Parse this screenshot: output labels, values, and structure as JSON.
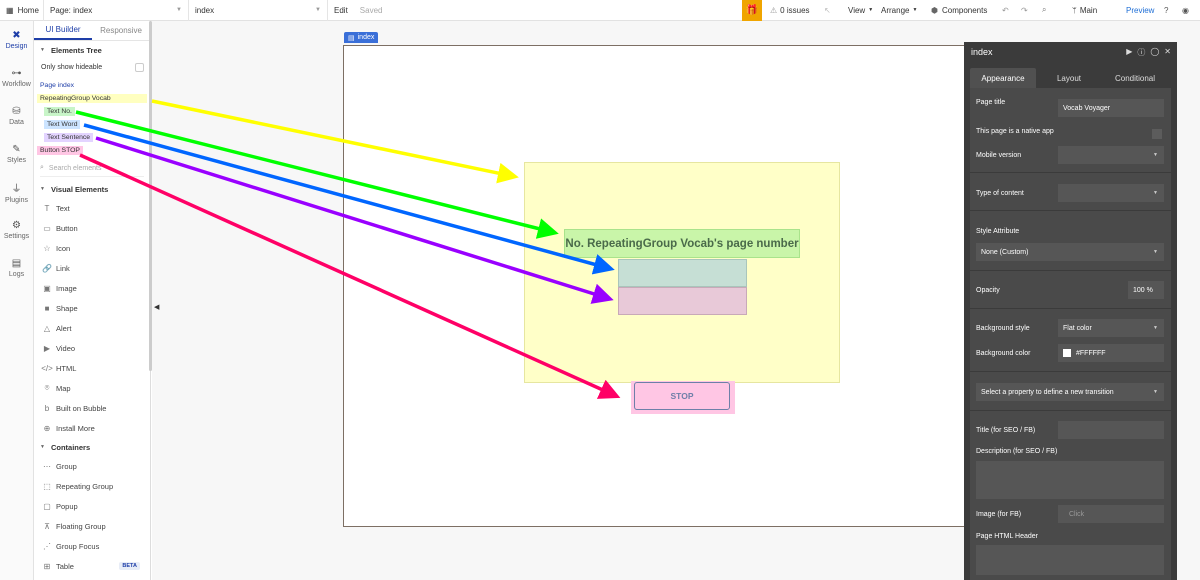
{
  "topbar": {
    "home": "Home",
    "page_label": "Page: index",
    "page_select": "index",
    "edit": "Edit",
    "saved": "Saved",
    "issues": "0 issues",
    "view": "View",
    "arrange": "Arrange",
    "components": "Components",
    "branch": "Main",
    "preview": "Preview"
  },
  "rail": [
    {
      "label": "Design",
      "icon": "design-icon"
    },
    {
      "label": "Workflow",
      "icon": "workflow-icon"
    },
    {
      "label": "Data",
      "icon": "data-icon"
    },
    {
      "label": "Styles",
      "icon": "styles-icon"
    },
    {
      "label": "Plugins",
      "icon": "plugins-icon"
    },
    {
      "label": "Settings",
      "icon": "settings-icon"
    },
    {
      "label": "Logs",
      "icon": "logs-icon"
    }
  ],
  "panel": {
    "tab_builder": "UI Builder",
    "tab_responsive": "Responsive",
    "elements_tree": "Elements Tree",
    "only_show_hideable": "Only show hideable",
    "tree": {
      "page": "Page index",
      "repeating_group": "RepeatingGroup Vocab",
      "text_no": "Text No.",
      "text_word": "Text Word",
      "text_sentence": "Text Sentence",
      "button_stop": "Button STOP"
    },
    "search_placeholder": "Search elements",
    "visual_elements": "Visual Elements",
    "visual": [
      "Text",
      "Button",
      "Icon",
      "Link",
      "Image",
      "Shape",
      "Alert",
      "Video",
      "HTML",
      "Map",
      "Built on Bubble",
      "Install More"
    ],
    "containers": "Containers",
    "container_items": [
      "Group",
      "Repeating Group",
      "Popup",
      "Floating Group",
      "Group Focus",
      "Table"
    ],
    "beta": "BETA"
  },
  "canvas": {
    "page_tag": "index",
    "text_no": "No. RepeatingGroup Vocab's page number",
    "button_stop": "STOP"
  },
  "props": {
    "title": "index",
    "tabs": [
      "Appearance",
      "Layout",
      "Conditional"
    ],
    "page_title_label": "Page title",
    "page_title_value": "Vocab Voyager",
    "native_app": "This page is a native app",
    "mobile_version": "Mobile version",
    "type_of_content": "Type of content",
    "style_attribute": "Style Attribute",
    "style_value": "None (Custom)",
    "opacity": "Opacity",
    "opacity_value": "100 %",
    "bg_style": "Background style",
    "bg_style_value": "Flat color",
    "bg_color": "Background color",
    "bg_color_value": "#FFFFFF",
    "transition": "Select a property to define a new transition",
    "seo_title": "Title (for SEO / FB)",
    "seo_desc": "Description (for SEO / FB)",
    "image_fb": "Image (for FB)",
    "image_fb_placeholder": "Click",
    "html_header": "Page HTML Header"
  },
  "colors": {
    "accent": "#1e3ea8",
    "arrow_yellow": "#ffff00",
    "arrow_green": "#00ff00",
    "arrow_blue": "#0066ff",
    "arrow_purple": "#9900ff",
    "arrow_pink": "#ff0066"
  }
}
